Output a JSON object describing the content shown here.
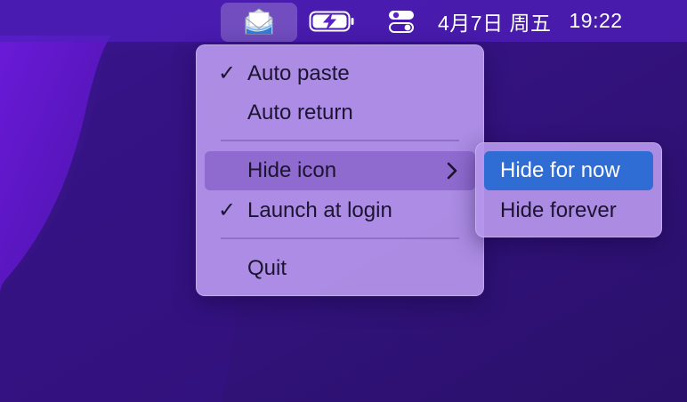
{
  "menubar": {
    "app_icon": "envelope-tray-icon",
    "battery_icon": "battery-charging-icon",
    "control_icon": "control-center-icon",
    "date": "4月7日 周五",
    "time": "19:22"
  },
  "main_menu": {
    "items": [
      {
        "label": "Auto paste",
        "checked": true
      },
      {
        "label": "Auto return",
        "checked": false
      },
      {
        "label": "Hide icon",
        "checked": false,
        "has_submenu": true
      },
      {
        "label": "Launch at login",
        "checked": true
      },
      {
        "label": "Quit",
        "checked": false
      }
    ],
    "check_glyph": "✓"
  },
  "sub_menu": {
    "items": [
      {
        "label": "Hide for now",
        "highlighted": true
      },
      {
        "label": "Hide forever",
        "highlighted": false
      }
    ]
  },
  "colors": {
    "menubar": "#5a22c4",
    "wallpaper": "#3a1590",
    "menu": "#b696ec",
    "highlight": "#2f6dd5"
  }
}
